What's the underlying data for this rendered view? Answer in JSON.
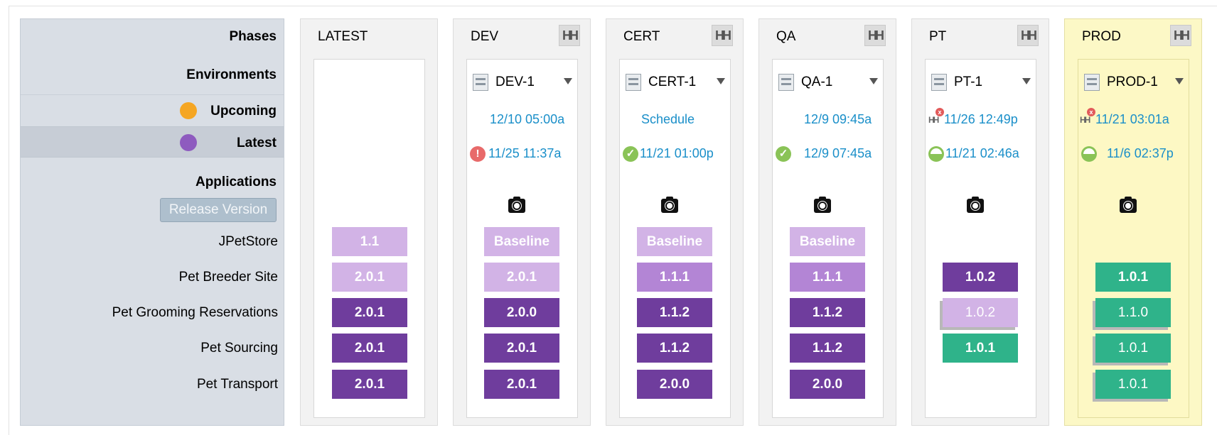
{
  "left_panel": {
    "phases_label": "Phases",
    "environments_label": "Environments",
    "upcoming_label": "Upcoming",
    "latest_label": "Latest",
    "applications_label": "Applications",
    "release_version_button": "Release Version",
    "colors": {
      "upcoming": "#f5a623",
      "latest": "#8e5bbf"
    }
  },
  "applications": [
    "JPetStore",
    "Pet Breeder Site",
    "Pet Grooming Reservations",
    "Pet Sourcing",
    "Pet Transport"
  ],
  "phases": [
    {
      "name": "LATEST",
      "has_compare": false,
      "versions": [
        "1.1",
        "2.0.1",
        "2.0.1",
        "2.0.1",
        "2.0.1"
      ]
    },
    {
      "name": "DEV",
      "has_compare": true,
      "env": "DEV-1",
      "schedule": "12/10 05:00a",
      "last_status": "11/25 11:37a",
      "last_icon": "error-icon",
      "versions": [
        "Baseline",
        "2.0.1",
        "2.0.0",
        "2.0.1",
        "2.0.1"
      ]
    },
    {
      "name": "CERT",
      "has_compare": true,
      "env": "CERT-1",
      "schedule": "Schedule",
      "last_status": "11/21 01:00p",
      "last_icon": "check-icon",
      "versions": [
        "Baseline",
        "1.1.1",
        "1.1.2",
        "1.1.2",
        "2.0.0"
      ]
    },
    {
      "name": "QA",
      "has_compare": true,
      "env": "QA-1",
      "schedule": "12/9 09:45a",
      "last_status": "12/9 07:45a",
      "last_icon": "check-icon",
      "versions": [
        "Baseline",
        "1.1.1",
        "1.1.2",
        "1.1.2",
        "2.0.0"
      ]
    },
    {
      "name": "PT",
      "has_compare": true,
      "env": "PT-1",
      "schedule": "11/26 12:49p",
      "last_status": "11/21 02:46a",
      "last_icon": "partial-icon",
      "versions": [
        "",
        "1.0.2",
        "1.0.2",
        "1.0.1",
        ""
      ]
    },
    {
      "name": "PROD",
      "has_compare": true,
      "env": "PROD-1",
      "schedule": "11/21 03:01a",
      "last_status": "11/6 02:37p",
      "last_icon": "partial-icon",
      "versions": [
        "",
        "1.0.1",
        "1.1.0",
        "1.0.1",
        "1.0.1"
      ]
    }
  ]
}
